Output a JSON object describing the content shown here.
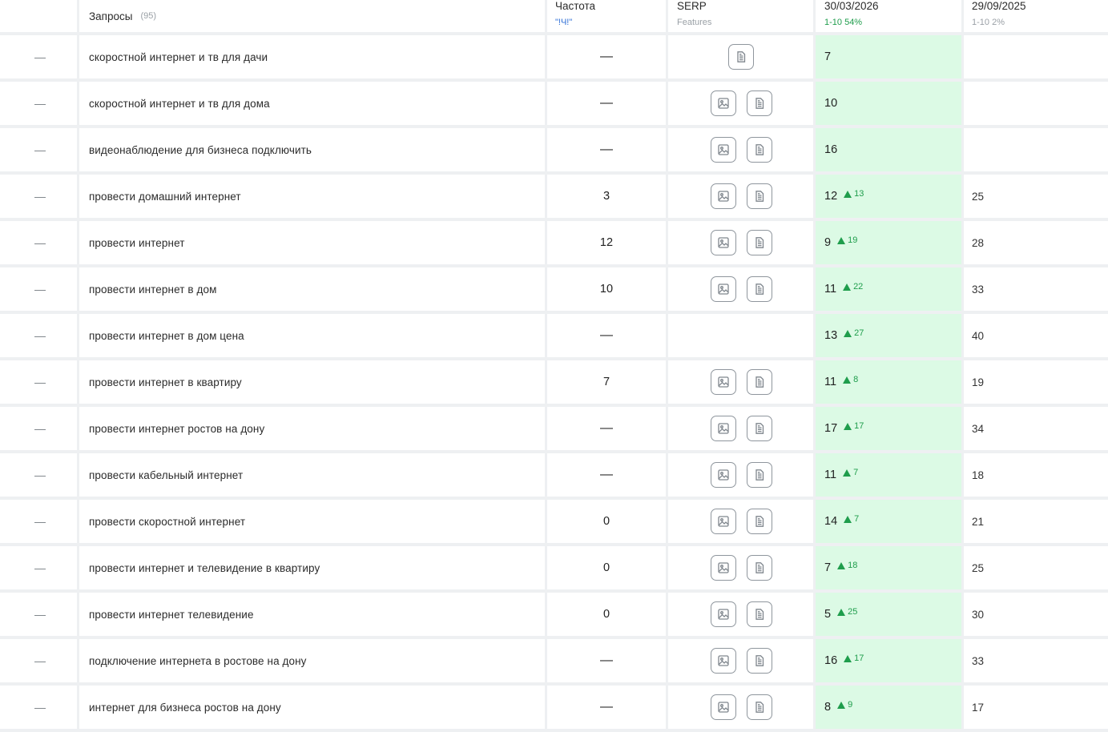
{
  "header": {
    "queries_label": "Запросы",
    "queries_count": "(95)",
    "freq_label": "Частота",
    "freq_sub": "\"!Ч!\"",
    "serp_label": "SERP",
    "serp_sub": "Features",
    "date1": "30/03/2026",
    "date1_sub": "1-10 54%",
    "date2": "29/09/2025",
    "date2_sub": "1-10 2%"
  },
  "colors": {
    "accent_green": "#1f9d4c",
    "position_bg": "#dcfae5",
    "link_blue": "#2f6fd6"
  },
  "rows": [
    {
      "dash": "—",
      "query": "скоростной интернет и тв для дачи",
      "freq": "—",
      "serp": [
        "doc-icon"
      ],
      "pos": "7",
      "delta": "",
      "prev": ""
    },
    {
      "dash": "—",
      "query": "скоростной интернет и тв для дома",
      "freq": "—",
      "serp": [
        "image-icon",
        "doc-icon"
      ],
      "pos": "10",
      "delta": "",
      "prev": ""
    },
    {
      "dash": "—",
      "query": "видеонаблюдение для бизнеса подключить",
      "freq": "—",
      "serp": [
        "image-icon",
        "doc-icon"
      ],
      "pos": "16",
      "delta": "",
      "prev": ""
    },
    {
      "dash": "—",
      "query": "провести домашний интернет",
      "freq": "3",
      "serp": [
        "image-icon",
        "doc-icon"
      ],
      "pos": "12",
      "delta": "13",
      "prev": "25"
    },
    {
      "dash": "—",
      "query": "провести интернет",
      "freq": "12",
      "serp": [
        "image-icon",
        "doc-icon"
      ],
      "pos": "9",
      "delta": "19",
      "prev": "28"
    },
    {
      "dash": "—",
      "query": "провести интернет в дом",
      "freq": "10",
      "serp": [
        "image-icon",
        "doc-icon"
      ],
      "pos": "11",
      "delta": "22",
      "prev": "33"
    },
    {
      "dash": "—",
      "query": "провести интернет в дом цена",
      "freq": "—",
      "serp": [],
      "pos": "13",
      "delta": "27",
      "prev": "40"
    },
    {
      "dash": "—",
      "query": "провести интернет в квартиру",
      "freq": "7",
      "serp": [
        "image-icon",
        "doc-icon"
      ],
      "pos": "11",
      "delta": "8",
      "prev": "19"
    },
    {
      "dash": "—",
      "query": "провести интернет ростов на дону",
      "freq": "—",
      "serp": [
        "image-icon",
        "doc-icon"
      ],
      "pos": "17",
      "delta": "17",
      "prev": "34"
    },
    {
      "dash": "—",
      "query": "провести кабельный интернет",
      "freq": "—",
      "serp": [
        "image-icon",
        "doc-icon"
      ],
      "pos": "11",
      "delta": "7",
      "prev": "18"
    },
    {
      "dash": "—",
      "query": "провести скоростной интернет",
      "freq": "0",
      "serp": [
        "image-icon",
        "doc-icon"
      ],
      "pos": "14",
      "delta": "7",
      "prev": "21"
    },
    {
      "dash": "—",
      "query": "провести интернет и телевидение в квартиру",
      "freq": "0",
      "serp": [
        "image-icon",
        "doc-icon"
      ],
      "pos": "7",
      "delta": "18",
      "prev": "25"
    },
    {
      "dash": "—",
      "query": "провести интернет телевидение",
      "freq": "0",
      "serp": [
        "image-icon",
        "doc-icon"
      ],
      "pos": "5",
      "delta": "25",
      "prev": "30"
    },
    {
      "dash": "—",
      "query": "подключение интернета в ростове на дону",
      "freq": "—",
      "serp": [
        "image-icon",
        "doc-icon"
      ],
      "pos": "16",
      "delta": "17",
      "prev": "33"
    },
    {
      "dash": "—",
      "query": "интернет для бизнеса ростов на дону",
      "freq": "—",
      "serp": [
        "image-icon",
        "doc-icon"
      ],
      "pos": "8",
      "delta": "9",
      "prev": "17"
    }
  ]
}
